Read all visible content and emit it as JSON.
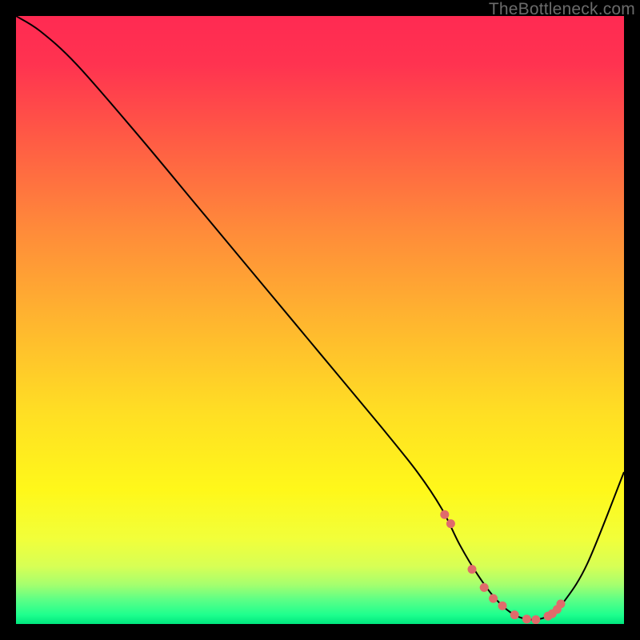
{
  "watermark": "TheBottleneck.com",
  "chart_data": {
    "type": "line",
    "title": "",
    "xlabel": "",
    "ylabel": "",
    "xlim": [
      0,
      100
    ],
    "ylim": [
      0,
      100
    ],
    "grid": false,
    "background_gradient": [
      {
        "stop": 0.0,
        "color": "#ff2a52"
      },
      {
        "stop": 0.08,
        "color": "#ff3350"
      },
      {
        "stop": 0.2,
        "color": "#ff5a45"
      },
      {
        "stop": 0.35,
        "color": "#ff8a3a"
      },
      {
        "stop": 0.5,
        "color": "#ffb52f"
      },
      {
        "stop": 0.65,
        "color": "#ffde24"
      },
      {
        "stop": 0.78,
        "color": "#fff81a"
      },
      {
        "stop": 0.86,
        "color": "#f1ff3a"
      },
      {
        "stop": 0.905,
        "color": "#d7ff55"
      },
      {
        "stop": 0.935,
        "color": "#a6ff6e"
      },
      {
        "stop": 0.96,
        "color": "#5cff86"
      },
      {
        "stop": 0.985,
        "color": "#1eff8e"
      },
      {
        "stop": 1.0,
        "color": "#00e67e"
      }
    ],
    "series": [
      {
        "name": "bottleneck-curve",
        "color": "#000000",
        "x": [
          0,
          4,
          10,
          20,
          30,
          40,
          50,
          60,
          66,
          70,
          73,
          76,
          79,
          82,
          85,
          88,
          90,
          94,
          100
        ],
        "y": [
          100,
          97.5,
          92,
          80.5,
          68.5,
          56.5,
          44.5,
          32.5,
          25,
          19,
          13,
          8,
          4,
          1.5,
          0.7,
          1.5,
          3.5,
          10,
          25
        ]
      }
    ],
    "highlight_points": {
      "name": "optimal-range",
      "color": "#e06b6b",
      "radius_px": 5.5,
      "x": [
        70.5,
        71.5,
        75.0,
        77.0,
        78.5,
        80.0,
        82.0,
        84.0,
        85.5,
        87.5,
        88.2,
        89.0,
        89.6
      ],
      "y": [
        18.0,
        16.5,
        9.0,
        6.0,
        4.2,
        3.0,
        1.5,
        0.8,
        0.7,
        1.3,
        1.7,
        2.4,
        3.3
      ]
    }
  }
}
